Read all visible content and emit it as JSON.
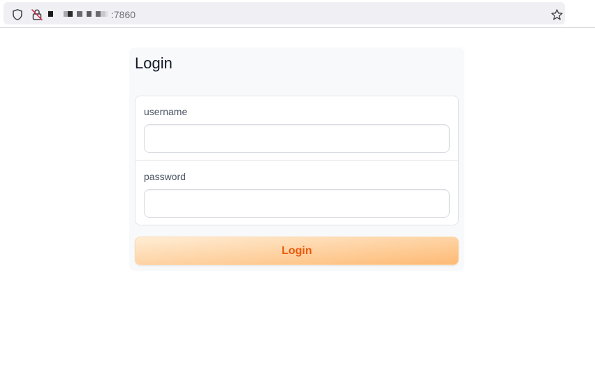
{
  "browser": {
    "url_port": ":7860",
    "icons": {
      "shield": "shield-icon",
      "lock": "lock-slash-icon",
      "star": "star-icon"
    }
  },
  "login": {
    "title": "Login",
    "username_label": "username",
    "username_value": "",
    "password_label": "password",
    "password_value": "",
    "button_label": "Login"
  },
  "colors": {
    "accent_text": "#ea580c",
    "button_gradient_start": "#ffedd5",
    "button_gradient_end": "#fdba74",
    "panel_bg": "#f8f9fb"
  }
}
